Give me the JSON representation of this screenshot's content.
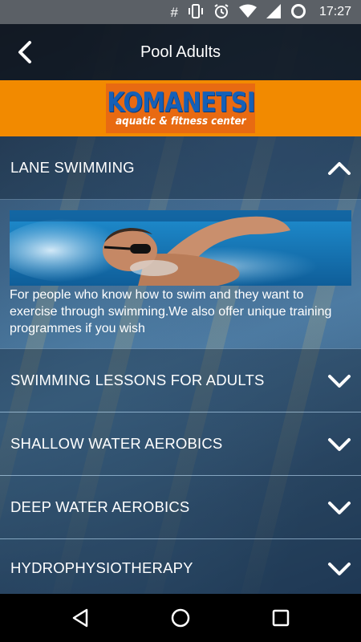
{
  "status_bar": {
    "icons": [
      "hash-icon",
      "vibrate-icon",
      "alarm-icon",
      "wifi-icon",
      "signal-icon",
      "battery-icon"
    ],
    "time": "17:27"
  },
  "app_bar": {
    "title": "Pool Adults"
  },
  "brand": {
    "name": "KOMANETSI",
    "tagline": "aquatic & fitness center",
    "colors": {
      "banner": "#f28a00",
      "logo_text": "#1560b8"
    }
  },
  "sections": [
    {
      "title": "LANE SWIMMING",
      "expanded": true,
      "description": "For people who know how to swim and they want to exercise through swimming.We also offer unique training programmes if you wish"
    },
    {
      "title": "SWIMMING LESSONS FOR ADULTS",
      "expanded": false
    },
    {
      "title": "SHALLOW WATER AEROBICS",
      "expanded": false
    },
    {
      "title": "DEEP WATER AEROBICS",
      "expanded": false
    },
    {
      "title": "HYDROPHYSIOTHERAPY",
      "expanded": false
    }
  ],
  "nav_bar": {
    "icons": [
      "back-triangle-icon",
      "home-circle-icon",
      "recents-square-icon"
    ]
  }
}
